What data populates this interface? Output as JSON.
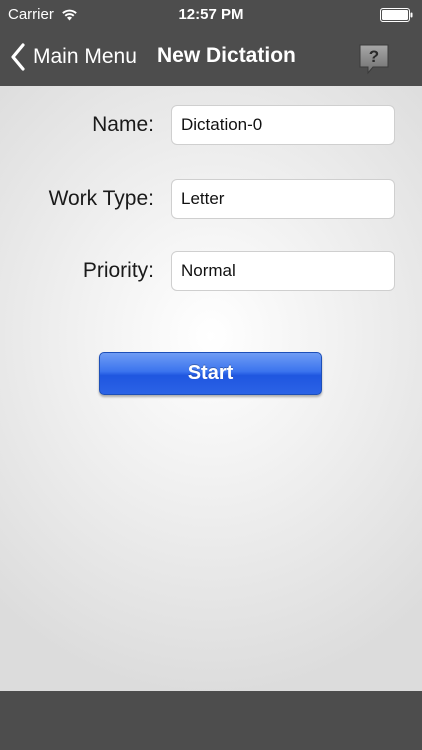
{
  "status_bar": {
    "carrier": "Carrier",
    "time": "12:57 PM",
    "icons": [
      "wifi-icon",
      "battery-icon"
    ]
  },
  "nav_bar": {
    "back_label": "Main Menu",
    "title": "New Dictation",
    "help_glyph": "?",
    "icons": [
      "chevron-left-icon",
      "help-icon"
    ]
  },
  "form": {
    "name": {
      "label": "Name:",
      "value": "Dictation-0"
    },
    "work_type": {
      "label": "Work Type:",
      "value": "Letter"
    },
    "priority": {
      "label": "Priority:",
      "value": "Normal"
    }
  },
  "start_button": {
    "label": "Start"
  },
  "colors": {
    "bars": "#4d4d4d",
    "start_button": "#2b63e6",
    "background": "#dcdcdc"
  }
}
